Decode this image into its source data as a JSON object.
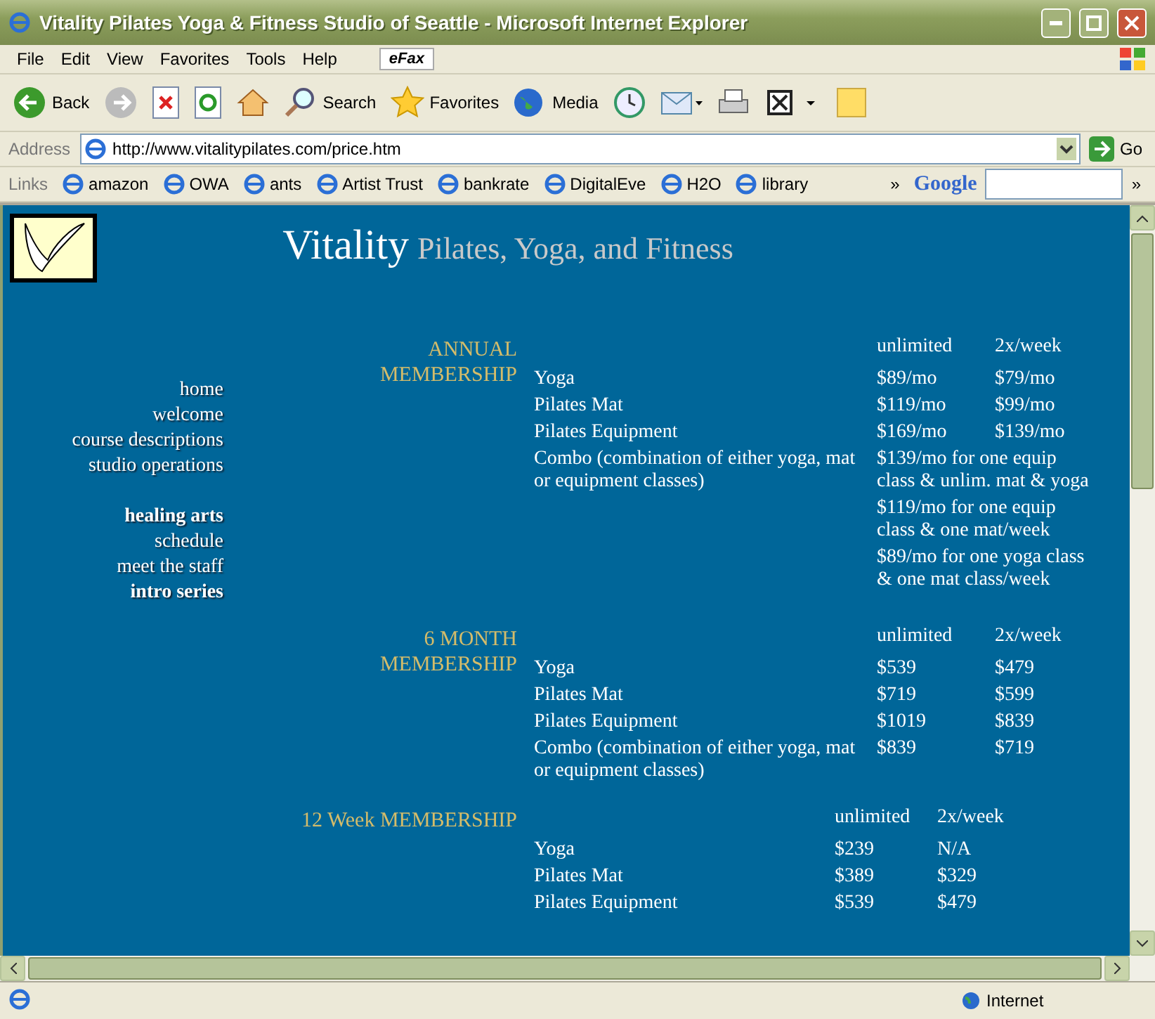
{
  "window": {
    "title": "Vitality Pilates Yoga & Fitness Studio of Seattle - Microsoft Internet Explorer"
  },
  "menu": [
    "File",
    "Edit",
    "View",
    "Favorites",
    "Tools",
    "Help"
  ],
  "efax": "eFax",
  "toolbar": [
    {
      "kind": "back",
      "label": "Back"
    },
    {
      "kind": "forward"
    },
    {
      "kind": "stop"
    },
    {
      "kind": "refresh"
    },
    {
      "kind": "home"
    },
    {
      "kind": "search",
      "label": "Search"
    },
    {
      "kind": "favorites",
      "label": "Favorites"
    },
    {
      "kind": "media",
      "label": "Media"
    },
    {
      "kind": "history"
    },
    {
      "kind": "mail"
    },
    {
      "kind": "print"
    },
    {
      "kind": "edit"
    },
    {
      "kind": "note"
    }
  ],
  "address": {
    "label": "Address",
    "url": "http://www.vitalitypilates.com/price.htm",
    "go": "Go"
  },
  "links": {
    "label": "Links",
    "items": [
      "amazon",
      "OWA",
      "ants",
      "Artist Trust",
      "bankrate",
      "DigitalEve",
      "H2O",
      "library"
    ],
    "more": "»",
    "google": "Google",
    "more_right": "»"
  },
  "page": {
    "brand": "Vitality",
    "tagline": "Pilates, Yoga, and Fitness",
    "nav_groups": [
      [
        {
          "label": "home",
          "bold": false
        },
        {
          "label": "welcome",
          "bold": false
        },
        {
          "label": "course descriptions",
          "bold": false
        },
        {
          "label": "studio operations",
          "bold": false
        }
      ],
      [
        {
          "label": "healing arts",
          "bold": true
        },
        {
          "label": "schedule",
          "bold": false
        },
        {
          "label": "meet the staff",
          "bold": false
        },
        {
          "label": "intro series",
          "bold": true
        }
      ]
    ],
    "sections": [
      {
        "title_lines": [
          "ANNUAL",
          "MEMBERSHIP"
        ],
        "kind": "wide",
        "columns": [
          "unlimited",
          "2x/week"
        ],
        "rows": [
          {
            "kind": "price",
            "item": "Yoga",
            "unlimited": "$89/mo",
            "twice": "$79/mo"
          },
          {
            "kind": "price",
            "item": "Pilates Mat",
            "unlimited": "$119/mo",
            "twice": "$99/mo"
          },
          {
            "kind": "price",
            "item": "Pilates Equipment",
            "unlimited": "$169/mo",
            "twice": "$139/mo"
          },
          {
            "kind": "note",
            "item": "Combo (combination of either yoga, mat or equipment classes)",
            "note": "$139/mo for one equip class & unlim. mat & yoga"
          },
          {
            "kind": "note",
            "note": "$119/mo for one equip class & one mat/week"
          },
          {
            "kind": "note",
            "note": "$89/mo for one yoga class & one mat class/week"
          }
        ]
      },
      {
        "title_lines": [
          "6 MONTH",
          "MEMBERSHIP"
        ],
        "kind": "wide",
        "columns": [
          "unlimited",
          "2x/week"
        ],
        "rows": [
          {
            "kind": "price",
            "item": "Yoga",
            "unlimited": "$539",
            "twice": "$479"
          },
          {
            "kind": "price",
            "item": "Pilates Mat",
            "unlimited": "$719",
            "twice": "$599"
          },
          {
            "kind": "price",
            "item": "Pilates Equipment",
            "unlimited": "$1019",
            "twice": "$839"
          },
          {
            "kind": "price",
            "item": "Combo (combination of either yoga, mat or equipment classes)",
            "unlimited": "$839",
            "twice": "$719"
          }
        ]
      },
      {
        "title_lines": [
          "12 Week MEMBERSHIP"
        ],
        "kind": "narrow",
        "columns": [
          "unlimited",
          "2x/week"
        ],
        "rows": [
          {
            "kind": "price",
            "item": "Yoga",
            "unlimited": "$239",
            "twice": "N/A"
          },
          {
            "kind": "price",
            "item": "Pilates Mat",
            "unlimited": "$389",
            "twice": "$329"
          },
          {
            "kind": "price",
            "item": "Pilates Equipment",
            "unlimited": "$539",
            "twice": "$479"
          }
        ]
      }
    ]
  },
  "status": {
    "zone": "Internet"
  }
}
